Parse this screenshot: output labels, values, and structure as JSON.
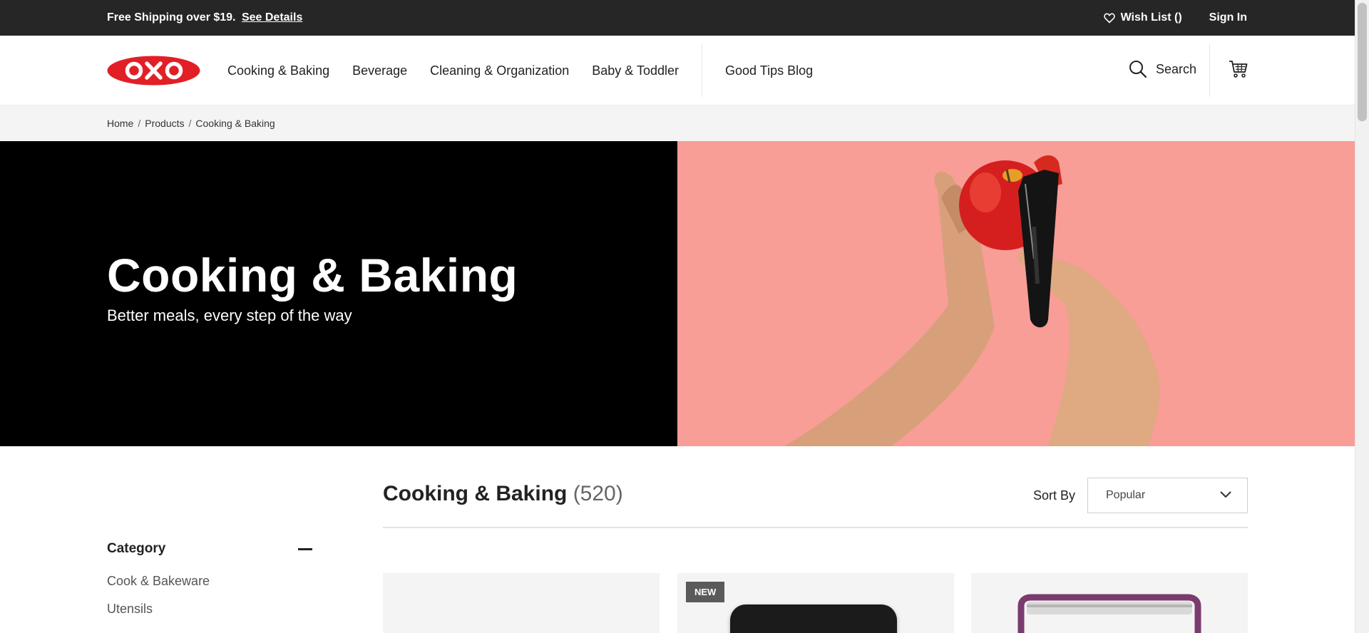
{
  "promo": {
    "text": "Free Shipping over $19.",
    "link": "See Details"
  },
  "account": {
    "wishlist": "Wish List ()",
    "signin": "Sign In"
  },
  "brand": {
    "logo_text": "OXO",
    "logo_color": "#e21f26"
  },
  "nav": {
    "items": [
      "Cooking & Baking",
      "Beverage",
      "Cleaning & Organization",
      "Baby & Toddler"
    ],
    "blog": "Good Tips Blog",
    "search": "Search"
  },
  "breadcrumb": [
    "Home",
    "Products",
    "Cooking & Baking"
  ],
  "hero": {
    "title": "Cooking & Baking",
    "subtitle": "Better meals, every step of the way",
    "right_bg": "#f99d97"
  },
  "listing": {
    "title": "Cooking & Baking",
    "count": "(520)",
    "sort_label": "Sort By",
    "sort_value": "Popular"
  },
  "sidebar": {
    "heading": "Category",
    "items": [
      "Cook & Bakeware",
      "Utensils"
    ]
  },
  "products": [
    {
      "badge": ""
    },
    {
      "badge": "NEW"
    },
    {
      "badge": ""
    }
  ]
}
